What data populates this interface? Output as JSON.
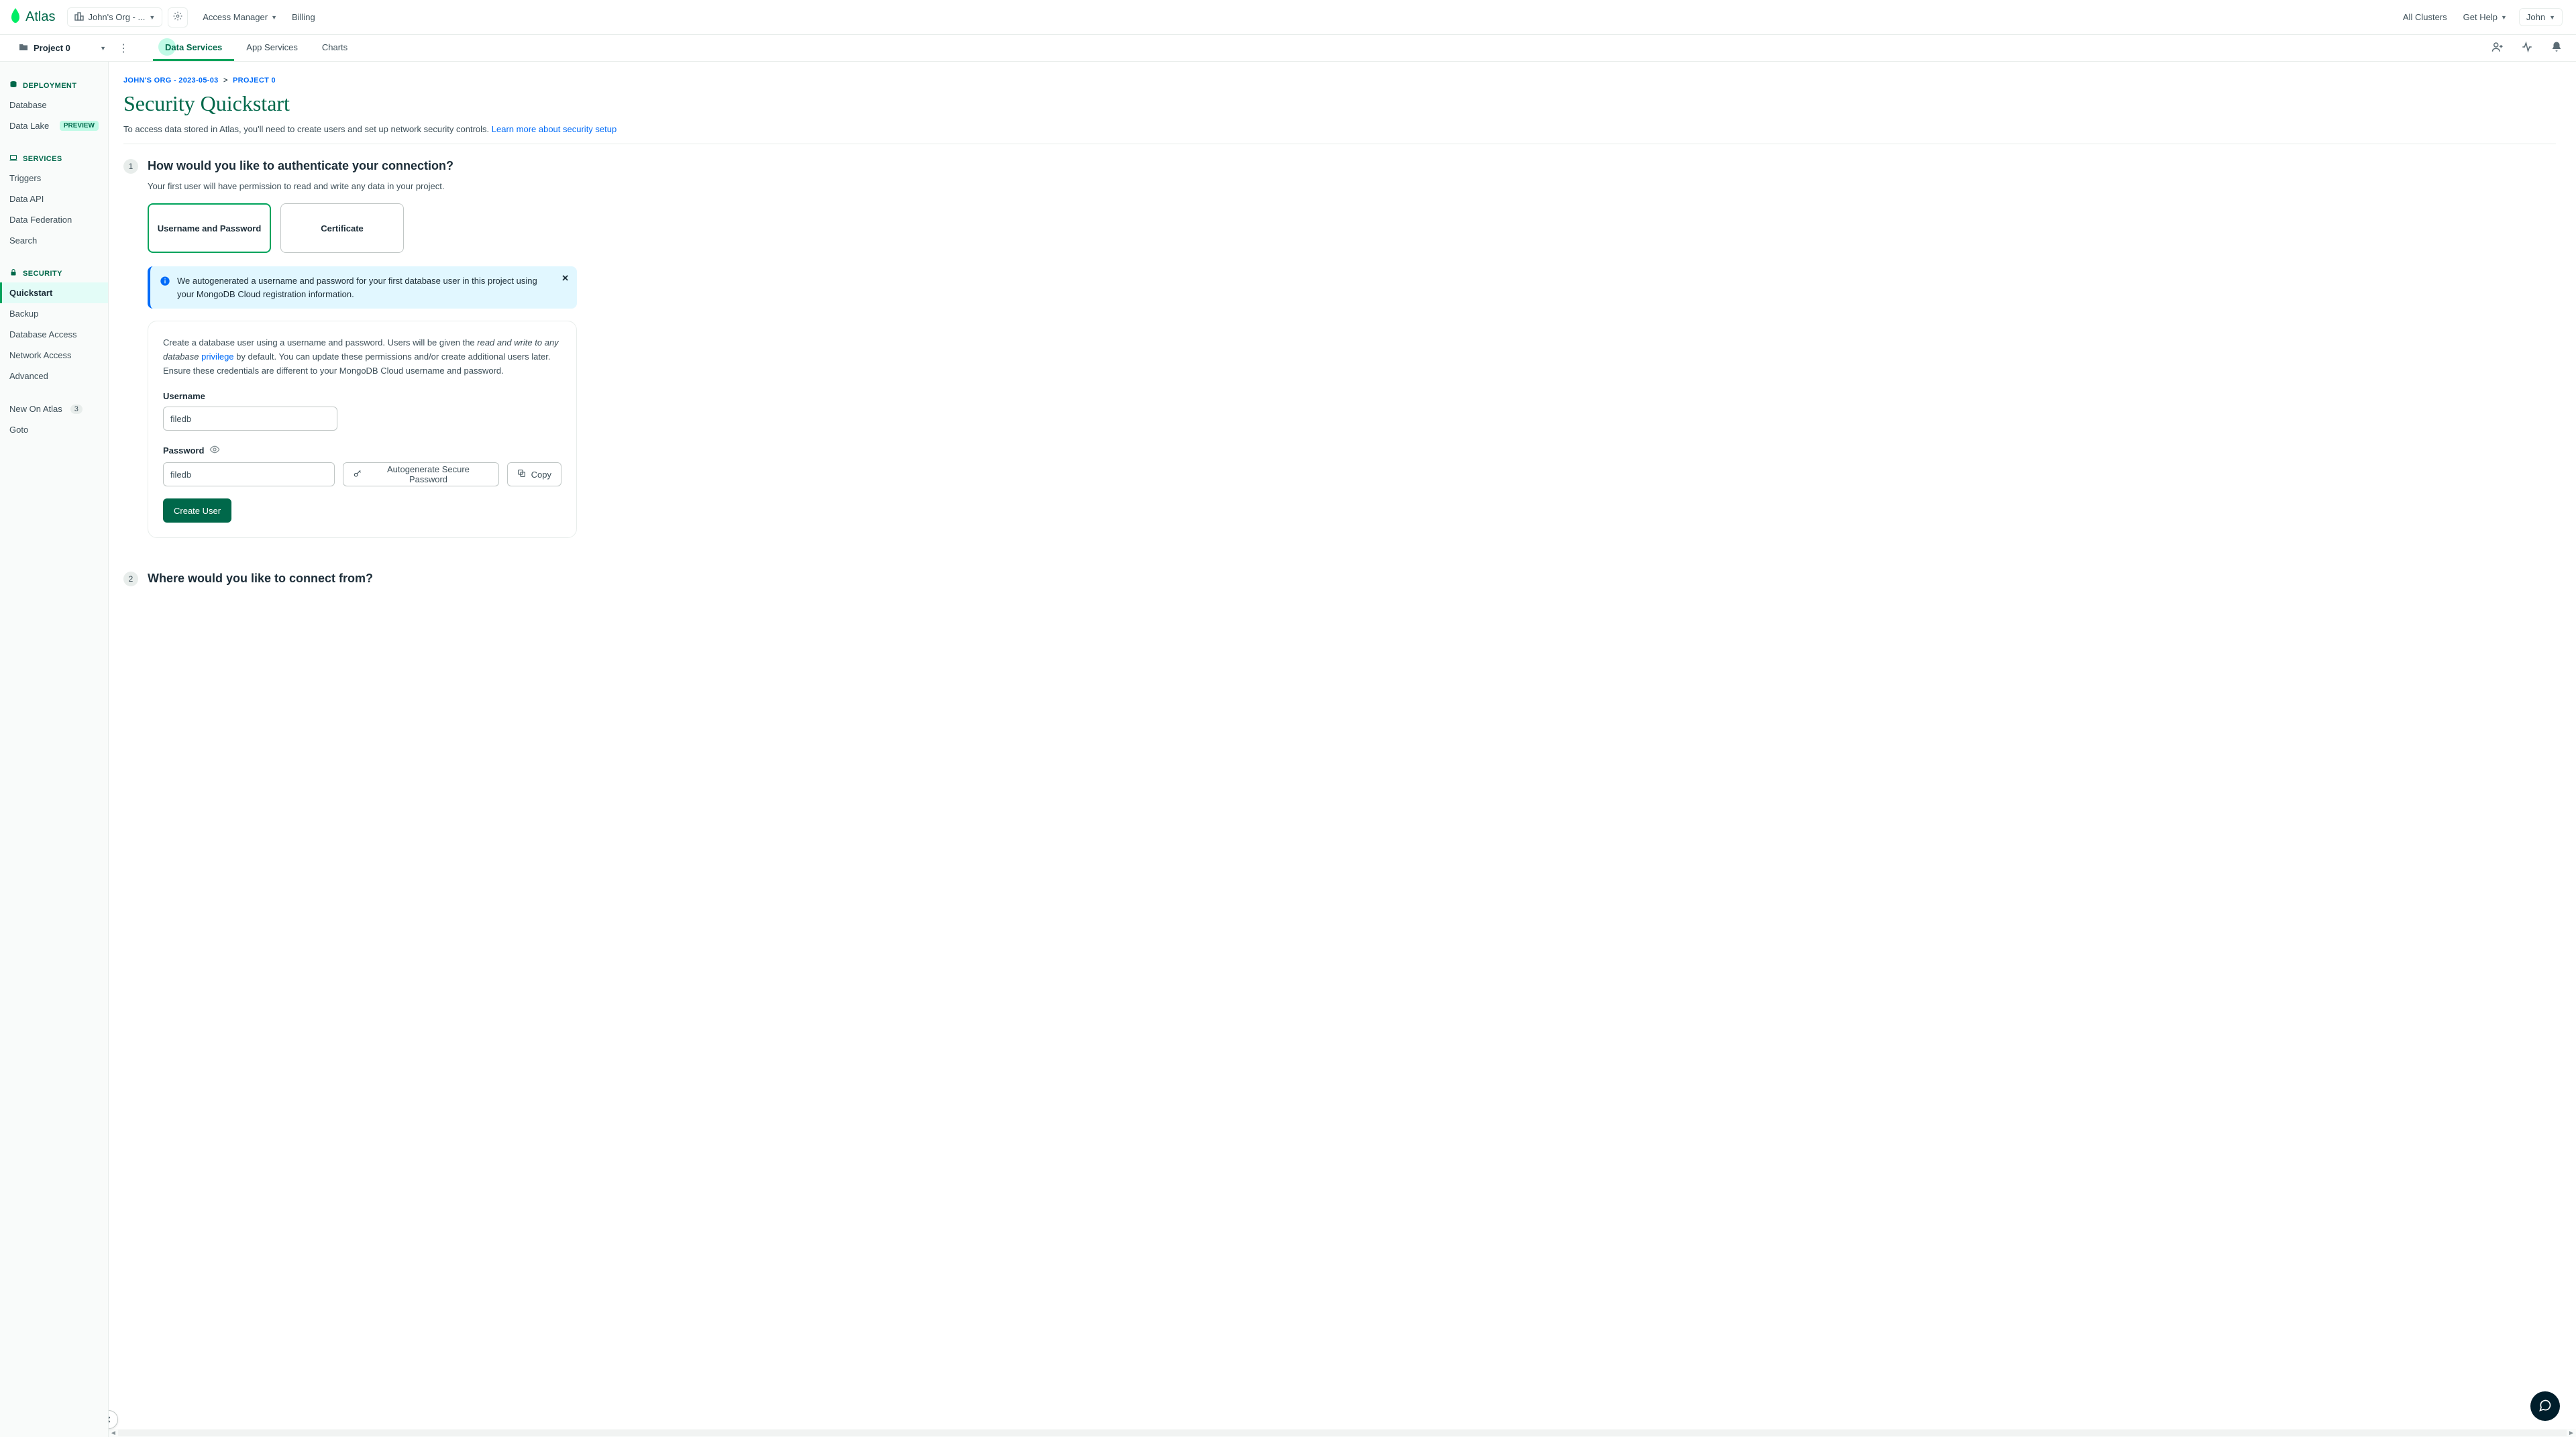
{
  "brand": "Atlas",
  "topbar": {
    "org_label": "John's Org - ...",
    "access_manager": "Access Manager",
    "billing": "Billing",
    "all_clusters": "All Clusters",
    "get_help": "Get Help",
    "user": "John"
  },
  "projectbar": {
    "project": "Project 0",
    "tabs": {
      "data_services": "Data Services",
      "app_services": "App Services",
      "charts": "Charts"
    }
  },
  "sidebar": {
    "sec_deployment": "DEPLOYMENT",
    "database": "Database",
    "datalake": "Data Lake",
    "datalake_badge": "PREVIEW",
    "sec_services": "SERVICES",
    "triggers": "Triggers",
    "dataapi": "Data API",
    "datafederation": "Data Federation",
    "search": "Search",
    "sec_security": "SECURITY",
    "quickstart": "Quickstart",
    "backup": "Backup",
    "dbaccess": "Database Access",
    "netaccess": "Network Access",
    "advanced": "Advanced",
    "new_on_atlas": "New On Atlas",
    "new_on_atlas_count": "3",
    "goto": "Goto"
  },
  "breadcrumb": {
    "org": "JOHN'S ORG - 2023-05-03",
    "project": "PROJECT 0"
  },
  "page": {
    "title": "Security Quickstart",
    "subtitle_prefix": "To access data stored in Atlas, you'll need to create users and set up network security controls. ",
    "subtitle_link": "Learn more about security setup"
  },
  "step1": {
    "num": "1",
    "title": "How would you like to authenticate your connection?",
    "desc": "Your first user will have permission to read and write any data in your project.",
    "card_userpass": "Username and Password",
    "card_cert": "Certificate",
    "banner": "We autogenerated a username and password for your first database user in this project using your MongoDB Cloud registration information.",
    "form": {
      "desc_prefix": "Create a database user using a username and password. Users will be given the ",
      "desc_em": "read and write to any database ",
      "desc_link": "privilege",
      "desc_suffix": " by default. You can update these permissions and/or create additional users later. Ensure these credentials are different to your MongoDB Cloud username and password.",
      "username_label": "Username",
      "username_value": "filedb",
      "password_label": "Password",
      "password_value": "filedb",
      "autogen": "Autogenerate Secure Password",
      "copy": "Copy",
      "create": "Create User"
    }
  },
  "step2": {
    "num": "2",
    "title": "Where would you like to connect from?"
  }
}
